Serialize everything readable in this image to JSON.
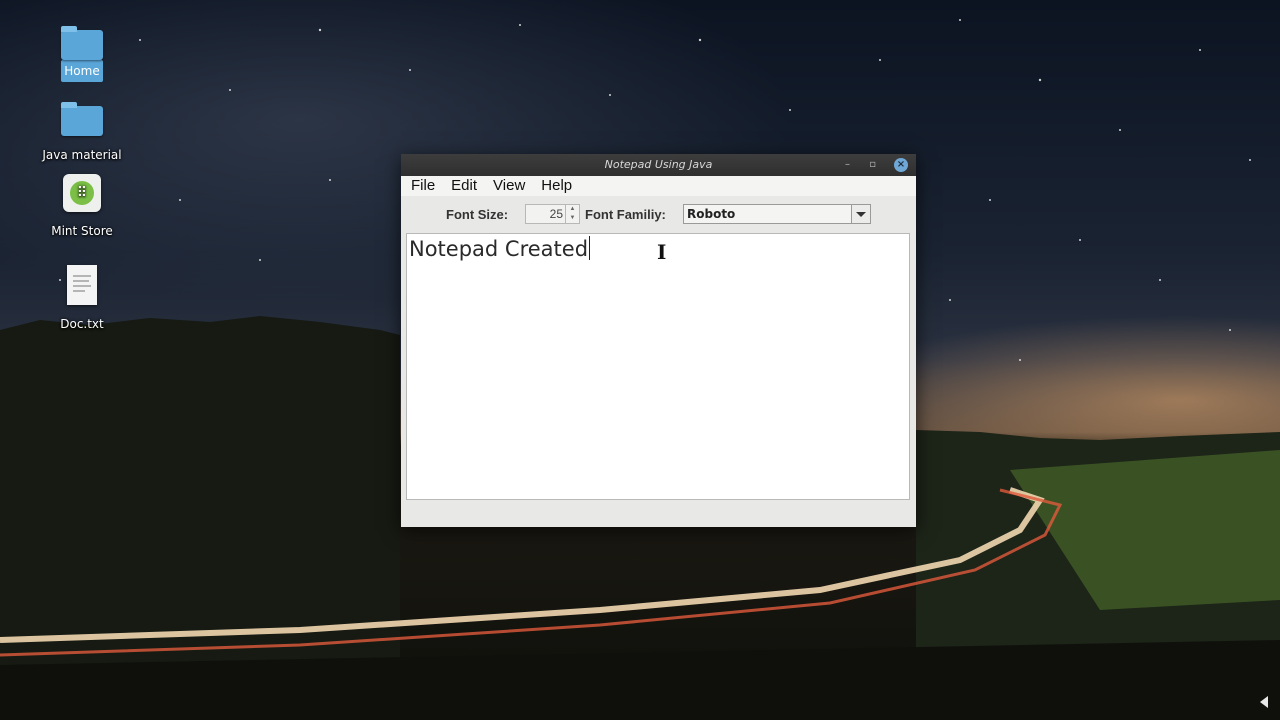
{
  "desktop": {
    "icons": [
      {
        "label": "Home",
        "icon": "home-folder-icon"
      },
      {
        "label": "Java material",
        "icon": "folder-icon"
      },
      {
        "label": "Mint Store",
        "icon": "mint-store-icon"
      },
      {
        "label": "Doc.txt",
        "icon": "text-document-icon"
      }
    ]
  },
  "window": {
    "title": "Notepad Using Java",
    "minimize_glyph": "–",
    "maximize_glyph": "▫",
    "close_glyph": "×",
    "menu": [
      "File",
      "Edit",
      "View",
      "Help"
    ],
    "toolbar": {
      "font_size_label": "Font Size:",
      "font_size_value": "25",
      "font_family_label": "Font Familiy:",
      "font_family_value": "Roboto"
    },
    "editor_text": "Notepad Created"
  },
  "colors": {
    "titlebar": "#2f2f2f",
    "close_button": "#6fa8d6",
    "folder": "#5aa6d8",
    "window_bg": "#e8e8e6"
  }
}
